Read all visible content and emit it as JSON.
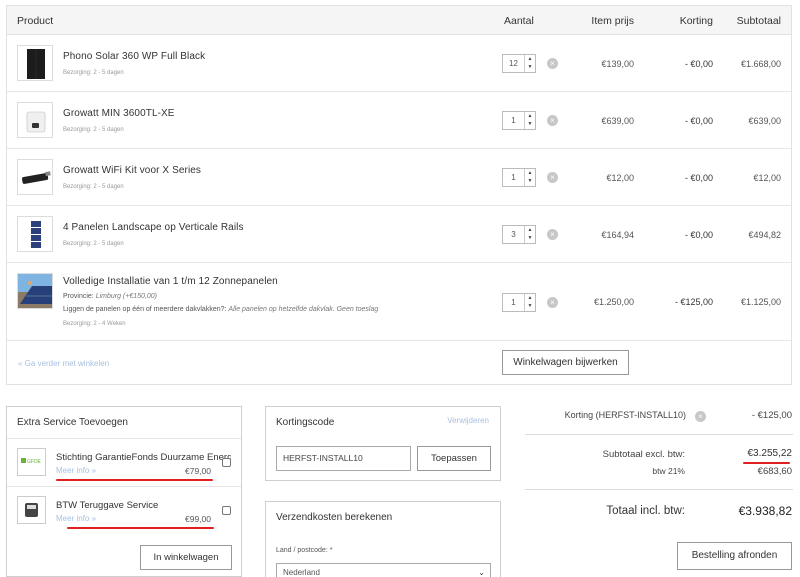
{
  "columns": {
    "product": "Product",
    "quantity": "Aantal",
    "item_price": "Item prijs",
    "discount": "Korting",
    "subtotal": "Subtotaal"
  },
  "items": [
    {
      "name": "Phono Solar 360 WP Full Black",
      "delivery": "Bezorging: 2 - 5 dagen",
      "quantity": "12",
      "price": "€139,00",
      "discount": "- €0,00",
      "subtotal": "€1.668,00",
      "image": "solar-panel-image"
    },
    {
      "name": "Growatt MIN 3600TL-XE",
      "delivery": "Bezorging: 2 - 5 dagen",
      "quantity": "1",
      "price": "€639,00",
      "discount": "- €0,00",
      "subtotal": "€639,00",
      "image": "inverter-image"
    },
    {
      "name": "Growatt WiFi Kit voor X Series",
      "delivery": "Bezorging: 2 - 5 dagen",
      "quantity": "1",
      "price": "€12,00",
      "discount": "- €0,00",
      "subtotal": "€12,00",
      "image": "wifi-stick-image"
    },
    {
      "name": "4 Panelen Landscape op Verticale Rails",
      "delivery": "Bezorging: 2 - 5 dagen",
      "quantity": "3",
      "price": "€164,94",
      "discount": "- €0,00",
      "subtotal": "€494,82",
      "image": "mounting-rails-image"
    },
    {
      "name": "Volledige Installatie van 1 t/m 12 Zonnepanelen",
      "province_label": "Provincie:",
      "province_value": "Limburg (+€150,00)",
      "roof_question": "Liggen de panelen op één of meerdere dakvlakken?:",
      "roof_answer": "Alle panelen op hetzelfde dakvlak. Geen toeslag",
      "delivery": "Bezorging: 2 - 4 Weken",
      "quantity": "1",
      "price": "€1.250,00",
      "discount": "- €125,00",
      "subtotal": "€1.125,00",
      "image": "installation-photo"
    }
  ],
  "continue_link": "« Ga verder met winkelen",
  "update_button": "Winkelwagen bijwerken",
  "extra_service": {
    "title": "Extra Service Toevoegen",
    "services": [
      {
        "name": "Stichting GarantieFonds Duurzame Energie",
        "more": "Meer info »",
        "price": "€79,00",
        "logo_text": "GFDE",
        "checked": false
      },
      {
        "name": "BTW Teruggave Service",
        "more": "Meer info »",
        "price": "€99,00",
        "checked": false
      }
    ],
    "add_button": "In winkelwagen"
  },
  "coupon": {
    "title": "Kortingscode",
    "remove": "Verwijderen",
    "code": "HERFST-INSTALL10",
    "apply_button": "Toepassen"
  },
  "shipping": {
    "title": "Verzendkosten berekenen",
    "country_label": "Land / postcode: *",
    "country_value": "Nederland"
  },
  "totals": {
    "discount_label": "Korting (HERFST-INSTALL10)",
    "discount_value": "- €125,00",
    "subtotal_label": "Subtotaal excl. btw:",
    "subtotal_value": "€3.255,22",
    "vat_label": "btw 21%",
    "vat_value": "€683,60",
    "total_label": "Totaal incl. btw:",
    "total_value": "€3.938,82",
    "checkout_button": "Bestelling afronden"
  },
  "colors": {
    "link": "#a8c0e0",
    "annotation_underline": "#e02020",
    "header_bg": "#f5f5f5"
  }
}
